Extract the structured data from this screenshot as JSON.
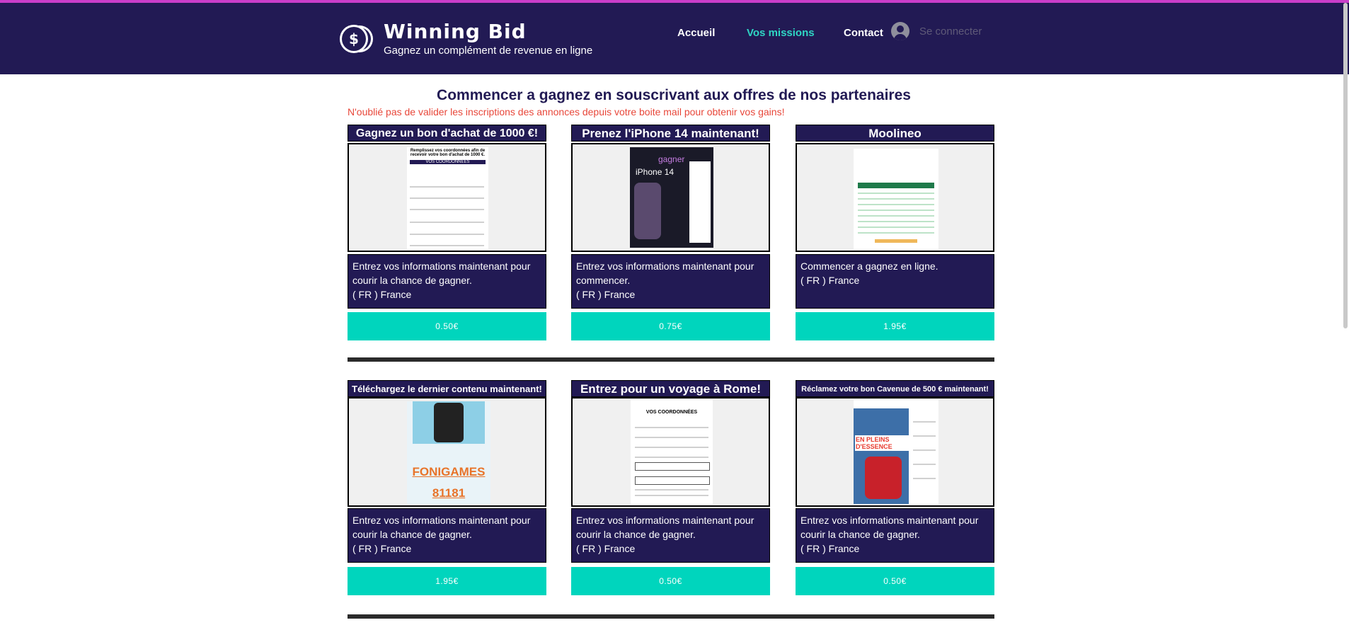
{
  "header": {
    "brand": "Winning Bid",
    "tagline": "Gagnez un complément de revenue en ligne",
    "nav": [
      "Accueil",
      "Vos missions",
      "Contact"
    ],
    "login": "Se connecter",
    "active_color": "#2fd6c4",
    "bg_color": "#221a54"
  },
  "main": {
    "title": "Commencer a gagnez en souscrivant aux offres de nos partenaires",
    "warning": "N'oublié pas de valider les inscriptions des annonces depuis votre boite mail pour obtenir vos gains!",
    "accent_color": "#00d5bd"
  },
  "offers": [
    {
      "title": "Gagnez un bon d'achat de 1000 €!",
      "desc1": "Entrez vos informations maintenant pour",
      "desc2": "courir la chance de gagner.",
      "desc3": " ( FR ) France",
      "price": "0.50€",
      "img_text_1": "Remplissez vos coordonnées afin de recevoir votre bon d'achat de 1000 €.",
      "img_text_2": "VOS COORDONNÉES"
    },
    {
      "title": "Prenez l'iPhone 14 maintenant!",
      "desc1": "Entrez vos informations maintenant pour",
      "desc2": "commencer.",
      "desc3": " ( FR ) France",
      "price": "0.75€",
      "img_text_1": "gagner",
      "img_text_2": "iPhone 14"
    },
    {
      "title": "Moolineo",
      "desc1": "Commencer a gagnez en ligne.",
      "desc2": " ( FR ) France",
      "desc3": "",
      "price": "1.95€",
      "img_text_1": "",
      "img_text_2": ""
    },
    {
      "title": "Téléchargez le dernier contenu maintenant!",
      "desc1": "Entrez vos informations maintenant pour",
      "desc2": "courir la chance de gagner.",
      "desc3": " ( FR ) France",
      "price": "1.95€",
      "img_text_1": "FONIGAMES",
      "img_text_2": "81181"
    },
    {
      "title": "Entrez pour un voyage à Rome!",
      "desc1": "Entrez vos informations maintenant pour",
      "desc2": "courir la chance de gagner.",
      "desc3": " ( FR ) France",
      "price": "0.50€",
      "img_text_1": "VOS COORDONNÉES",
      "img_text_2": ""
    },
    {
      "title": "Réclamez votre bon Cavenue de 500 € maintenant!",
      "desc1": "Entrez vos informations maintenant pour",
      "desc2": "courir la chance de gagner.",
      "desc3": " ( FR ) France",
      "price": "0.50€",
      "img_text_1": "EN PLEINS D'ESSENCE",
      "img_text_2": ""
    }
  ]
}
